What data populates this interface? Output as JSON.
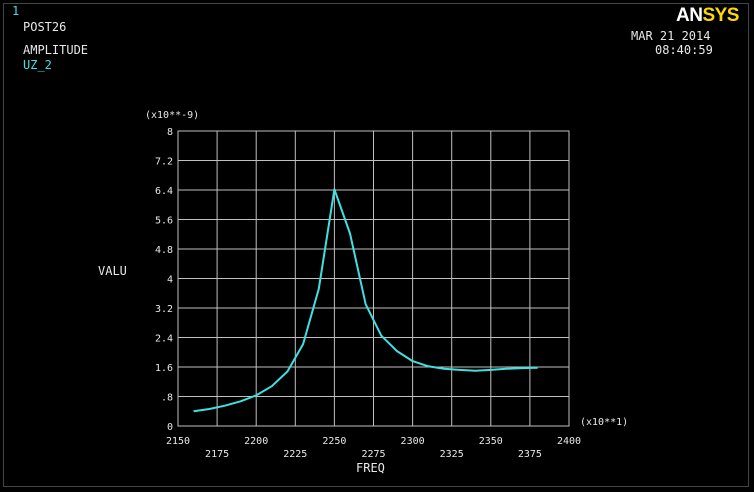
{
  "window": {
    "number": "1"
  },
  "header": {
    "program": "POST26",
    "result_type": "AMPLITUDE",
    "variable": "UZ_2",
    "date": "MAR 21 2014",
    "time": "08:40:59",
    "logo_part1": "AN",
    "logo_part2": "SYS"
  },
  "colors": {
    "background": "#000000",
    "curve": "#40e0e0",
    "grid": "#c0c0c0",
    "text": "#e8e8e8",
    "logo_accent": "#ffd800"
  },
  "chart_data": {
    "type": "line",
    "xlabel": "FREQ",
    "ylabel": "VALU",
    "x_multiplier": "(x10**1)",
    "y_multiplier": "(x10**-9)",
    "xlim": [
      2150,
      2400
    ],
    "ylim": [
      0,
      8
    ],
    "x_ticks_lower": [
      "2150",
      "2200",
      "2250",
      "2300",
      "2350",
      "2400"
    ],
    "x_ticks_upper": [
      "2175",
      "2225",
      "2275",
      "2325",
      "2375"
    ],
    "y_ticks": [
      "0",
      ".8",
      "1.6",
      "2.4",
      "3.2",
      "4",
      "4.8",
      "5.6",
      "6.4",
      "7.2",
      "8"
    ],
    "grid": true,
    "series": [
      {
        "x": [
          2160,
          2170,
          2180,
          2190,
          2200,
          2210,
          2220,
          2230,
          2240,
          2250,
          2260,
          2270,
          2280,
          2290,
          2300,
          2310,
          2320,
          2330,
          2340,
          2350,
          2360,
          2370,
          2380
        ],
        "values": [
          0.4,
          0.46,
          0.55,
          0.67,
          0.83,
          1.08,
          1.48,
          2.22,
          3.72,
          6.42,
          5.22,
          3.3,
          2.45,
          2.03,
          1.76,
          1.62,
          1.55,
          1.52,
          1.5,
          1.52,
          1.55,
          1.57,
          1.58
        ]
      }
    ]
  }
}
